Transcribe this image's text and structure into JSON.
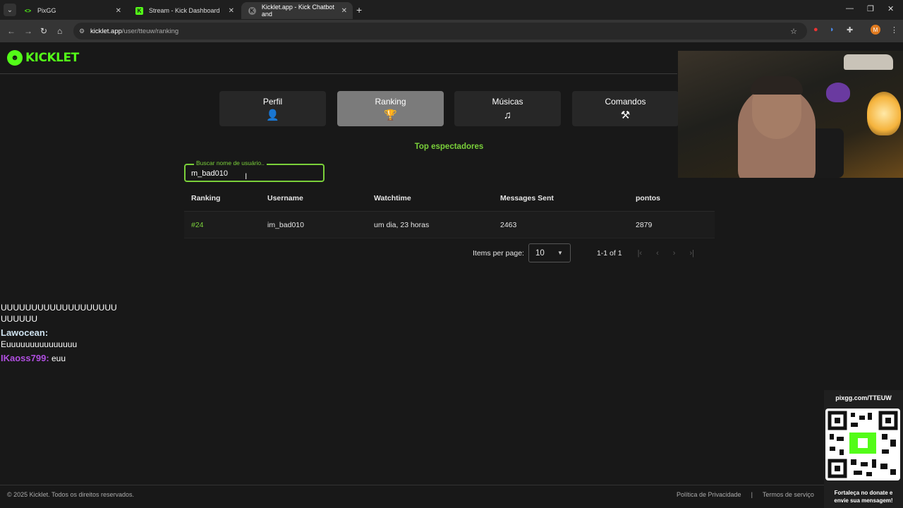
{
  "browser": {
    "tabs": [
      {
        "title": "PixGG",
        "favicon": "pixgg-icon",
        "close": "✕"
      },
      {
        "title": "Stream - Kick Dashboard",
        "favicon": "kick-icon",
        "close": "✕"
      },
      {
        "title": "Kicklet.app - Kick Chatbot and",
        "favicon": "kicklet-icon",
        "close": "✕"
      }
    ],
    "new_tab": "+",
    "url_host": "kicklet.app",
    "url_path": "/user/tteuw/ranking",
    "profile_initial": "M"
  },
  "app": {
    "logo_text": "KICKLET",
    "nav": [
      {
        "label": "Perfil",
        "icon": "person-icon",
        "glyph": "👤"
      },
      {
        "label": "Ranking",
        "icon": "trophy-icon",
        "glyph": "🏆"
      },
      {
        "label": "Músicas",
        "icon": "playlist-icon",
        "glyph": "♫"
      },
      {
        "label": "Comandos",
        "icon": "tools-icon",
        "glyph": "⚒"
      }
    ],
    "section_title": "Top espectadores",
    "search": {
      "label": "Buscar nome de usuário..",
      "value": "m_bad010"
    },
    "table": {
      "headers": [
        "Ranking",
        "Username",
        "Watchtime",
        "Messages Sent",
        "pontos"
      ],
      "rows": [
        [
          "#24",
          "im_bad010",
          "um dia, 23 horas",
          "2463",
          "2879"
        ]
      ]
    },
    "pagination": {
      "items_per_page_label": "Items per page:",
      "items_per_page": "10",
      "range": "1-1 of 1"
    },
    "footer": {
      "copyright": "© 2025 Kicklet. Todos os direitos reservados.",
      "privacy": "Política de Privacidade",
      "separator": "|",
      "terms": "Termos de serviço"
    }
  },
  "overlay": {
    "chat": [
      {
        "text": "UUUUUUUUUUUUUUUUUUU"
      },
      {
        "text": "UUUUUU"
      },
      {
        "name": "Lawocean:",
        "text": "Euuuuuuuuuuuuuuu"
      },
      {
        "name": "IKaoss799:",
        "text": "euu"
      }
    ],
    "donation_url": "pixgg.com/TTEUW",
    "donation_msg_line1": "Fortaleça no donate e",
    "donation_msg_line2": "envie sua mensagem!"
  },
  "colors": {
    "accent": "#7ad03a",
    "brand": "#53fc18",
    "background": "#181818"
  }
}
